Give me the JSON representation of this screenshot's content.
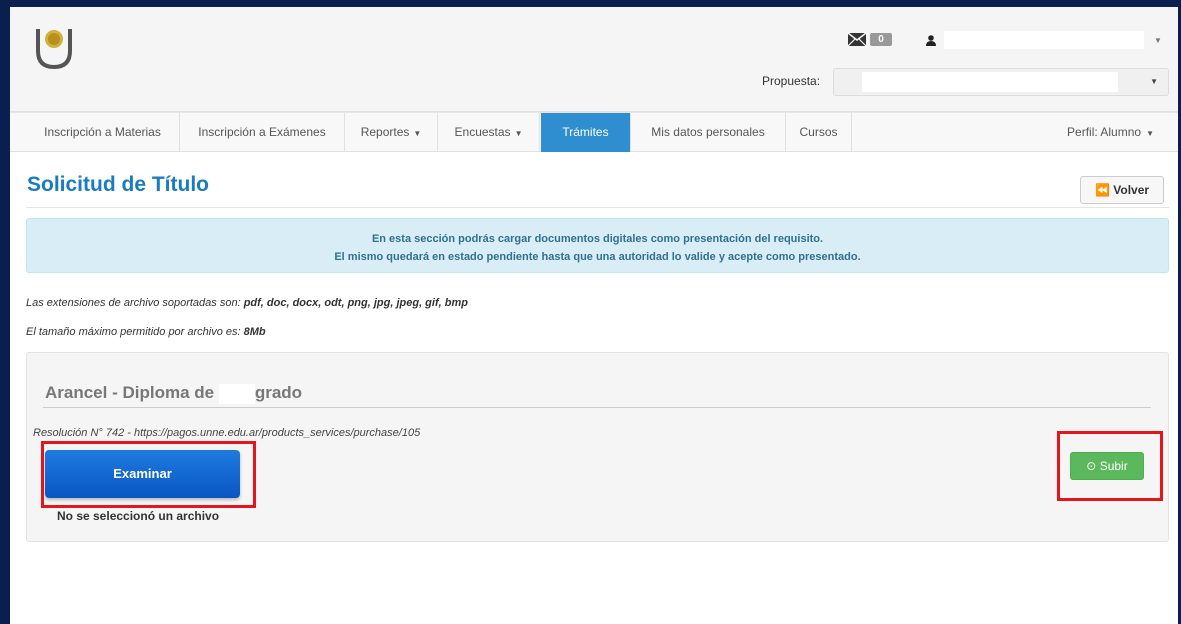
{
  "header": {
    "mail_count": "0",
    "propuesta_label": "Propuesta:"
  },
  "nav": {
    "items": [
      {
        "label": "Inscripción a Materias"
      },
      {
        "label": "Inscripción a Exámenes"
      },
      {
        "label": "Reportes"
      },
      {
        "label": "Encuestas"
      },
      {
        "label": "Trámites"
      },
      {
        "label": "Mis datos personales"
      },
      {
        "label": "Cursos"
      }
    ],
    "perfil": "Perfil: Alumno"
  },
  "page": {
    "title": "Solicitud de Título",
    "back_button": "Volver",
    "info_line1": "En esta sección podrás cargar documentos digitales como presentación del requisito.",
    "info_line2": "El mismo quedará en estado pendiente hasta que una autoridad lo valide y acepte como presentado.",
    "ext_prefix": "Las extensiones de archivo soportadas son: ",
    "ext_values": "pdf, doc, docx, odt, png, jpg, jpeg, gif, bmp",
    "size_prefix": "El tamaño máximo permitido por archivo es: ",
    "size_value": "8Mb"
  },
  "panel": {
    "title_part1": "Arancel - Diploma de",
    "title_part2": "grado",
    "resolucion": "Resolución N° 742 - https://pagos.unne.edu.ar/products_services/purchase/105",
    "browse_button": "Examinar",
    "no_file_text": "No se seleccionó un archivo",
    "upload_button": "Subir"
  },
  "colors": {
    "accent": "#2f8ecf",
    "title": "#1a7cc0",
    "highlight": "#e8141c",
    "upload": "#5cb85c"
  }
}
